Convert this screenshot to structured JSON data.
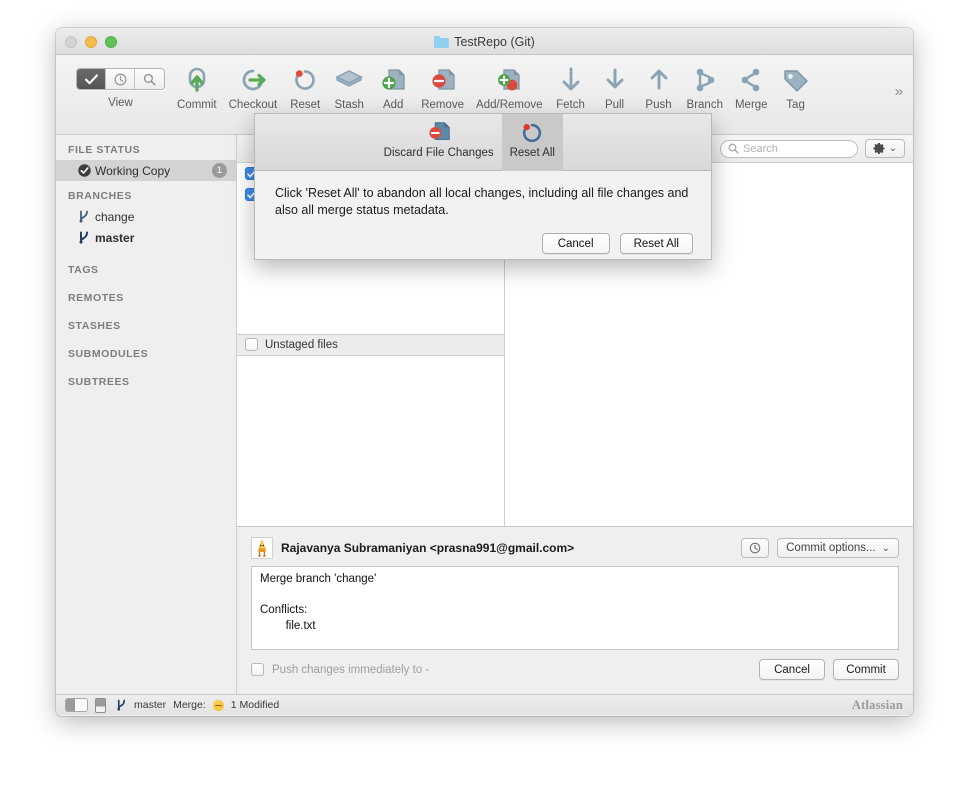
{
  "window": {
    "title": "TestRepo (Git)",
    "folder_icon": "folder-icon",
    "traffic_lights": [
      "close",
      "minimize",
      "maximize"
    ]
  },
  "toolbar": {
    "view_label": "View",
    "view_segments": [
      "check-icon",
      "clock-icon",
      "search-icon"
    ],
    "items": [
      {
        "label": "Commit",
        "icon": "commit-icon"
      },
      {
        "label": "Checkout",
        "icon": "checkout-icon"
      },
      {
        "label": "Reset",
        "icon": "reset-icon"
      },
      {
        "label": "Stash",
        "icon": "stash-icon"
      },
      {
        "label": "Add",
        "icon": "add-icon"
      },
      {
        "label": "Remove",
        "icon": "remove-icon"
      },
      {
        "label": "Add/Remove",
        "icon": "add-remove-icon"
      },
      {
        "label": "Fetch",
        "icon": "fetch-icon"
      },
      {
        "label": "Pull",
        "icon": "pull-icon"
      },
      {
        "label": "Push",
        "icon": "push-icon"
      },
      {
        "label": "Branch",
        "icon": "branch-icon"
      },
      {
        "label": "Merge",
        "icon": "merge-icon"
      },
      {
        "label": "Tag",
        "icon": "tag-icon"
      }
    ],
    "overflow_label": "»"
  },
  "sidebar": {
    "sections": [
      {
        "title": "FILE STATUS",
        "items": [
          {
            "label": "Working Copy",
            "badge": "1",
            "selected": true,
            "icon": "check-circle-icon"
          }
        ]
      },
      {
        "title": "BRANCHES",
        "items": [
          {
            "label": "change",
            "icon": "branch-icon",
            "bold": false
          },
          {
            "label": "master",
            "icon": "branch-icon",
            "bold": true
          }
        ]
      },
      {
        "title": "TAGS",
        "items": []
      },
      {
        "title": "REMOTES",
        "items": []
      },
      {
        "title": "STASHES",
        "items": []
      },
      {
        "title": "SUBMODULES",
        "items": []
      },
      {
        "title": "SUBTREES",
        "items": []
      }
    ]
  },
  "main": {
    "search": {
      "placeholder": "Search",
      "value": "",
      "icon": "search-icon"
    },
    "gear_button": {
      "icon": "gear-icon",
      "chevron": "⌄"
    },
    "staged_rows": [
      {
        "checked": true
      },
      {
        "checked": true
      }
    ],
    "splitbar": {
      "label": "Unstaged files",
      "checked": false
    }
  },
  "commit_panel": {
    "author": "Rajavanya Subramaniyan <prasna991@gmail.com>",
    "avatar": "user-avatar",
    "history_button": {
      "icon": "clock-icon"
    },
    "commit_options_label": "Commit options...",
    "commit_options_chevron": "⌄",
    "message": "Merge branch 'change'\n\nConflicts:\n\tfile.txt",
    "push_checkbox_label": "Push changes immediately to -",
    "push_checkbox_checked": false,
    "cancel_label": "Cancel",
    "commit_label": "Commit"
  },
  "statusbar": {
    "sidebar_toggle": "sidebar-toggle-icon",
    "panel_toggle": "panel-toggle-icon",
    "branch_icon": "branch-icon",
    "branch": "master",
    "merge_label": "Merge:",
    "status_dot_color": "#f0b92a",
    "modified": "1 Modified",
    "brand": "Atlassian"
  },
  "popover": {
    "tabs": [
      {
        "label": "Discard File Changes",
        "icon": "discard-file-icon",
        "active": false
      },
      {
        "label": "Reset All",
        "icon": "reset-icon",
        "active": true
      }
    ],
    "message": "Click 'Reset All' to abandon all local changes, including all file changes and also all merge status metadata.",
    "cancel_label": "Cancel",
    "confirm_label": "Reset All"
  },
  "colors": {
    "accent_blue": "#3b8ef0",
    "icon_green": "#5aab56",
    "icon_red": "#d94a3d",
    "icon_blue_gray": "#8aa3b5",
    "icon_steel": "#5f87a8",
    "status_yellow": "#f0b92a"
  }
}
